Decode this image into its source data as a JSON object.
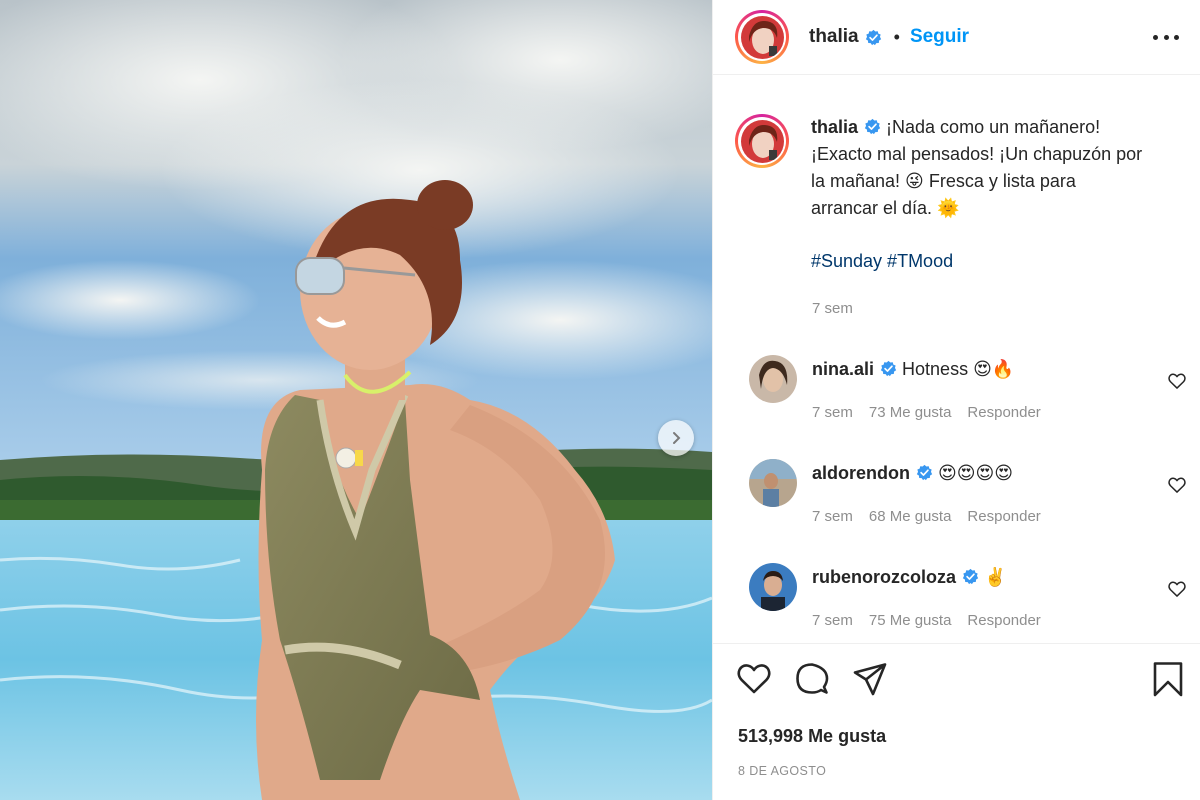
{
  "post": {
    "username": "thalia",
    "follow_label": "Seguir",
    "separator": "•",
    "caption_lines": [
      "¡Nada como un mañanero!",
      "¡Exacto mal pensados! ¡Un chapuzón por",
      "la mañana! 😜 Fresca y lista para",
      "arrancar el día. 🌞"
    ],
    "hashtags": "#Sunday #TMood",
    "caption_time": "7 sem",
    "likes_total": "513,998 Me gusta",
    "date": "8 DE AGOSTO"
  },
  "comments": [
    {
      "username": "nina.ali",
      "text": "Hotness 😍🔥",
      "time": "7 sem",
      "likes": "73 Me gusta",
      "reply": "Responder"
    },
    {
      "username": "aldorendon",
      "text": "😍😍😍😍",
      "time": "7 sem",
      "likes": "68 Me gusta",
      "reply": "Responder"
    },
    {
      "username": "rubenorozcoloza",
      "text": "✌️",
      "time": "7 sem",
      "likes": "75 Me gusta",
      "reply": "Responder"
    }
  ],
  "colors": {
    "link_blue": "#0095f6",
    "hashtag_blue": "#00376b",
    "verified_blue": "#3897f0",
    "muted": "#8e8e8e"
  },
  "icons": [
    "more-options-icon",
    "verified-badge-icon",
    "carousel-next-icon",
    "heart-icon",
    "comment-icon",
    "share-icon",
    "bookmark-icon"
  ]
}
